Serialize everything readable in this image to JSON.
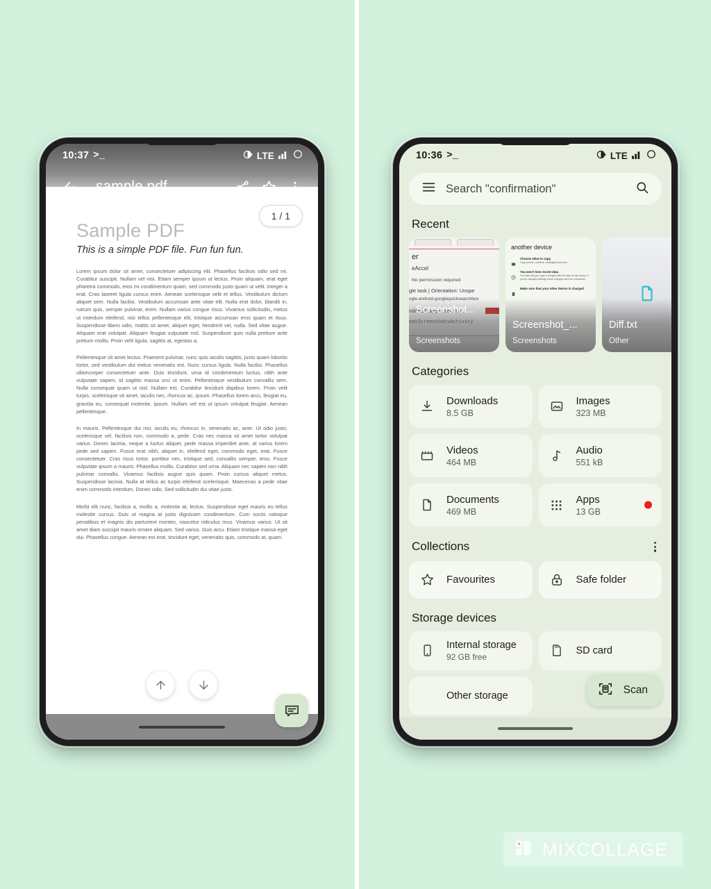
{
  "canvas": {
    "background_color": "#d3f2de",
    "divider_color": "#ffffff"
  },
  "left_phone": {
    "status_bar": {
      "time": "10:37",
      "terminal_glyph": ">_",
      "network": "LTE"
    },
    "app_bar": {
      "title": "sample.pdf",
      "back_icon": "back-arrow-icon",
      "share_icon": "share-icon",
      "star_icon": "star-outline-icon",
      "overflow_icon": "more-vertical-icon"
    },
    "page_indicator": "1 / 1",
    "document": {
      "heading": "Sample PDF",
      "subheading": "This is a simple PDF file. Fun fun fun.",
      "paragraphs": [
        "Lorem ipsum dolor sit amet, consectetuer adipiscing elit. Phasellus facilisis odio sed mi. Curabitur suscipit. Nullam vel nisi. Etiam semper ipsum ut lectus. Proin aliquam, erat eget pharetra commodo, eros mi condimentum quam, sed commodo justo quam ut velit. Integer a erat. Cras laoreet ligula cursus enim. Aenean scelerisque velit et tellus. Vestibulum dictum aliquet sem. Nulla facilisi. Vestibulum accumsan ante vitae elit. Nulla erat dolor, blandit in, rutrum quis, semper pulvinar, enim. Nullam varius congue risus. Vivamus sollicitudin, metus ut interdum eleifend, nisi tellus pellentesque elit, tristique accumsan eros quam et risus. Suspendisse libero odio, mattis sit amet, aliquet eget, hendrerit vel, nulla. Sed vitae augue. Aliquam erat volutpat. Aliquam feugiat vulputate nisl. Suspendisse quis nulla pretium ante pretium mollis. Proin velit ligula, sagittis at, egestas a,",
        "Pellentesque sit amet lectus. Praesent pulvinar, nunc quis iaculis sagittis, justo quam lobortis tortor, sed vestibulum dui metus venenatis est. Nunc cursus ligula. Nulla facilisi. Phasellus ullamcorper consectetuer ante. Duis tincidunt, urna id condimentum luctus, nibh ante vulputate sapien, id sagittis massa orci ut enim. Pellentesque vestibulum convallis sem. Nulla consequat quam ut nisl. Nullam est. Curabitur tincidunt dapibus lorem. Proin velit turpis, scelerisque sit amet, iaculis nec, rhoncus ac, ipsum. Phasellus lorem arcu, feugiat eu, gravida eu, consequat molestie, ipsum. Nullam vel est ut ipsum volutpat feugiat. Aenean pellentesque.",
        "In mauris. Pellentesque dui nisi, iaculis eu, rhoncus in, venenatis ac, ante. Ut odio justo, scelerisque vel, facilisis non, commodo a, pede. Cras nec massa sit amet tortor volutpat varius. Donec lacinia, neque a luctus aliquet, pede massa imperdiet ante, at varius lorem pede sed sapien. Fusce erat nibh, aliquet in, eleifend eget, commodo eget, erat. Fusce consectetuer. Cras risus tortor, porttitor nec, tristique sed, convallis semper, eros. Fusce vulputate ipsum a mauris. Phasellus mollis. Curabitur sed urna. Aliquam nec sapien non nibh pulvinar convallis. Vivamus facilisis augue quis quam. Proin cursus aliquet metus. Suspendisse lacinia. Nulla at tellus ac turpis eleifend scelerisque. Maecenas a pede vitae enim commodo interdum. Donec odio. Sed sollicitudin dui vitae justo.",
        "Morbi elit nunc, facilisis a, mollis a, molestie at, lectus. Suspendisse eget mauris eu tellus molestie cursus. Duis ut magna at justo dignissim condimentum. Cum sociis natoque penatibus et magnis dis parturient montes, nascetur ridiculus mus. Vivamus varius. Ut sit amet diam suscipit mauris ornare aliquam. Sed varius. Duis arcu. Etiam tristique massa eget dui. Phasellus congue. Aenean est erat, tincidunt eget, venenatis quis, commodo at, quam."
      ]
    },
    "nav_buttons": {
      "up_icon": "arrow-up-icon",
      "down_icon": "arrow-down-icon"
    },
    "fab": {
      "icon": "comment-icon",
      "color": "#d6e8cf"
    }
  },
  "right_phone": {
    "status_bar": {
      "time": "10:36",
      "terminal_glyph": ">_",
      "network": "LTE"
    },
    "search": {
      "value": "Search \"confirmation\"",
      "menu_icon": "hamburger-menu-icon",
      "search_icon": "search-icon"
    },
    "recent": {
      "title": "Recent",
      "items": [
        {
          "name": "Screenshot...",
          "sub": "Screenshots",
          "preview_lines": [
            "er",
            "eAccel",
            "No permission required",
            "gle task | Orientation: Unspe",
            "ogle.android.googlequicksearchbox",
            "ndroid.apps.search.",
            "eatScreenshotsActivity"
          ]
        },
        {
          "name": "Screenshot_...",
          "sub": "Screenshots",
          "preview_title": "another device",
          "preview_items": [
            {
              "title": "Choose what to copy",
              "desc": "Copy photos, contacts, messages and more"
            },
            {
              "title": "You won't lose recent data",
              "desc": "The data that you copy is merged with the data on this device. If you've changed settings, those changes won't be overwritten."
            },
            {
              "title": "Make sure that your other device is charged",
              "desc": ""
            }
          ]
        },
        {
          "name": "Diff.txt",
          "sub": "Other",
          "file_icon_color": "#35bcd8"
        }
      ]
    },
    "categories": {
      "title": "Categories",
      "items": [
        {
          "label": "Downloads",
          "size": "8.5 GB",
          "icon": "download-icon"
        },
        {
          "label": "Images",
          "size": "323 MB",
          "icon": "image-icon"
        },
        {
          "label": "Videos",
          "size": "464 MB",
          "icon": "video-clapper-icon"
        },
        {
          "label": "Audio",
          "size": "551 kB",
          "icon": "music-note-icon"
        },
        {
          "label": "Documents",
          "size": "469 MB",
          "icon": "document-icon"
        },
        {
          "label": "Apps",
          "size": "13 GB",
          "icon": "apps-grid-icon",
          "badge_color": "#e8201a"
        }
      ]
    },
    "collections": {
      "title": "Collections",
      "overflow_icon": "more-vertical-icon",
      "items": [
        {
          "label": "Favourites",
          "icon": "star-outline-icon"
        },
        {
          "label": "Safe folder",
          "icon": "lock-icon"
        }
      ]
    },
    "storage_devices": {
      "title": "Storage devices",
      "items": [
        {
          "label": "Internal storage",
          "sub": "92 GB free",
          "icon": "phone-icon"
        },
        {
          "label": "SD card",
          "sub": "",
          "icon": "sd-card-icon"
        },
        {
          "label": "Other storage",
          "sub": "",
          "icon": "folder-icon"
        }
      ]
    },
    "scan_chip": {
      "label": "Scan",
      "icon": "scan-document-icon",
      "color": "#d6e8cf"
    }
  },
  "watermark": {
    "text": "MIXCOLLAGE",
    "icon": "mixcollage-logo-icon"
  }
}
